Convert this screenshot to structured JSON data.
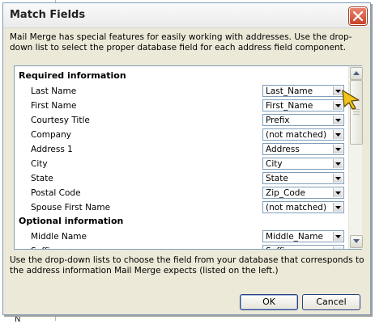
{
  "dialog": {
    "title": "Match Fields",
    "intro": "Mail Merge has special features for easily working with addresses.  Use the drop-down list to select the proper database field for each address field component.",
    "hint": "Use the drop-down lists to choose the field from your database that corresponds to the address information Mail Merge expects (listed on the left.)",
    "ok_label": "OK",
    "cancel_label": "Cancel"
  },
  "required": {
    "header": "Required information",
    "fields": [
      {
        "label": "Last Name",
        "value": "Last_Name"
      },
      {
        "label": "First Name",
        "value": "First_Name"
      },
      {
        "label": "Courtesy Title",
        "value": "Prefix"
      },
      {
        "label": "Company",
        "value": "(not matched)"
      },
      {
        "label": "Address 1",
        "value": "Address"
      },
      {
        "label": "City",
        "value": "City"
      },
      {
        "label": "State",
        "value": "State"
      },
      {
        "label": "Postal Code",
        "value": "Zip_Code"
      },
      {
        "label": "Spouse First Name",
        "value": "(not matched)"
      }
    ]
  },
  "optional": {
    "header": "Optional information",
    "fields": [
      {
        "label": "Middle Name",
        "value": "Middle_Name"
      },
      {
        "label": "Suffix",
        "value": "Suffix"
      }
    ]
  },
  "background": {
    "partial_text": "N"
  },
  "icons": {
    "close": "close-icon",
    "dropdown": "chevron-down-icon",
    "cursor": "arrow-cursor-icon"
  },
  "colors": {
    "dialog_bg": "#ece9d8",
    "close_red": "#c9412a",
    "border_blue": "#7f9db9",
    "cursor_yellow": "#f0c419"
  }
}
